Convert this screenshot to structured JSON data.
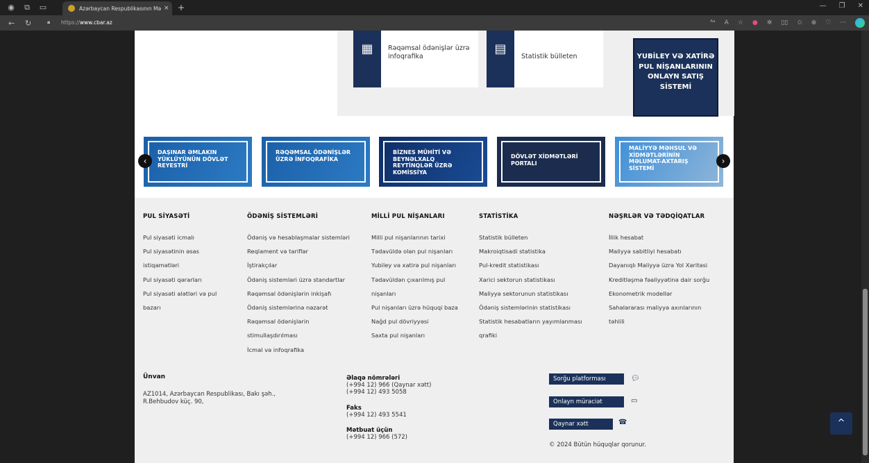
{
  "browser": {
    "tab_title": "Azərbaycan Respublikasının Mərkəzi Bankı",
    "tab_close": "×",
    "new_tab": "+",
    "url_prefix": "https://",
    "url_host": "www.cbar.az"
  },
  "tiles": [
    {
      "label": "Rəqəmsal ödənişlər üzrə infoqrafika"
    },
    {
      "label": "Statistik bülleten"
    }
  ],
  "yubiley": "YUBİLEY VƏ XATİRƏ PUL NİŞANLARININ ONLAYN SATIŞ SİSTEMİ",
  "banners": [
    "DAŞINAR ƏMLAKIN YÜKLÜYÜNÜN DÖVLƏT REYESTRİ",
    "RƏQƏMSAL ÖDƏNİŞLƏR ÜZRƏ İNFOQRAFİKA",
    "BİZNES MÜHİTİ VƏ BEYNƏLXALQ REYTİNQLƏR ÜZRƏ KOMİSSİYA",
    "DÖVLƏT XİDMƏTLƏRİ PORTALI",
    "MALİYYƏ MƏHSUL VƏ XİDMƏTLƏRİNİN MƏLUMAT-AXTARIŞ SİSTEMİ"
  ],
  "footer": {
    "columns": [
      {
        "title": "PUL SİYASƏTİ",
        "links": [
          "Pul siyasəti icmalı",
          "Pul siyasətinin əsas",
          "istiqamətləri",
          "Pul siyasəti qərarları",
          "Pul siyasəti alətləri və pul",
          "bazarı"
        ]
      },
      {
        "title": "ÖDƏNİŞ SİSTEMLƏRİ",
        "links": [
          "Ödəniş və hesablaşmalar sistemləri",
          "Reqlament və tariflər",
          "İştirakçılar",
          "Ödəniş sistemləri üzrə standartlar",
          "Rəqəmsal ödənişlərin inkişafı",
          "Ödəniş sistemlərinə nəzarət",
          "Rəqəmsal ödənişlərin",
          "stimullaşdırılması",
          "İcmal və infoqrafika"
        ]
      },
      {
        "title": "MİLLİ PUL NİŞANLARI",
        "links": [
          "Milli pul nişanlarının tarixi",
          "Tədavüldə olan pul nişanları",
          "Yubiley və xatirə pul nişanları",
          "Tədavüldən çıxarılmış pul",
          "nişanları",
          "Pul nişanları üzrə hüquqi baza",
          "Nağd pul dövriyyəsi",
          "Saxta pul nişanları"
        ]
      },
      {
        "title": "STATİSTİKA",
        "links": [
          "Statistik bülleten",
          "Makroiqtisadi statistika",
          "Pul-kredit statistikası",
          "Xarici sektorun statistikası",
          "Maliyyə sektorunun statistikası",
          "Ödəniş sistemlərinin statistikası",
          "Statistik hesabatların yayımlanması",
          "qrafiki"
        ]
      },
      {
        "title": "NƏŞRLƏR VƏ TƏDQİQATLAR",
        "links": [
          "İllik hesabat",
          "Maliyyə sabitliyi hesabatı",
          "Dayanıqlı Maliyyə üzrə Yol Xəritəsi",
          "Kreditləşmə fəaliyyətinə dair sorğu",
          "Ekonometrik modellər",
          "Sahələrarası maliyyə axınlarının",
          "təhlili"
        ]
      }
    ],
    "address_title": "Ünvan",
    "address_line1": "AZ1014, Azərbaycan Respublikası, Bakı şəh.,",
    "address_line2": "R.Behbudov küç. 90,",
    "phones_title": "Əlaqə nömrələri",
    "phone1": "(+994 12) 966 (Qaynar xətt)",
    "phone2": "(+994 12) 493 5058",
    "fax_title": "Faks",
    "fax": "(+994 12) 493 5541",
    "press_title": "Mətbuat üçün",
    "press": "(+994 12) 966 (572)",
    "buttons": [
      "Sorğu platforması",
      "Onlayn müraciət",
      "Qaynar xətt"
    ],
    "copyright": "© 2024 Bütün hüquqlar qorunur."
  }
}
